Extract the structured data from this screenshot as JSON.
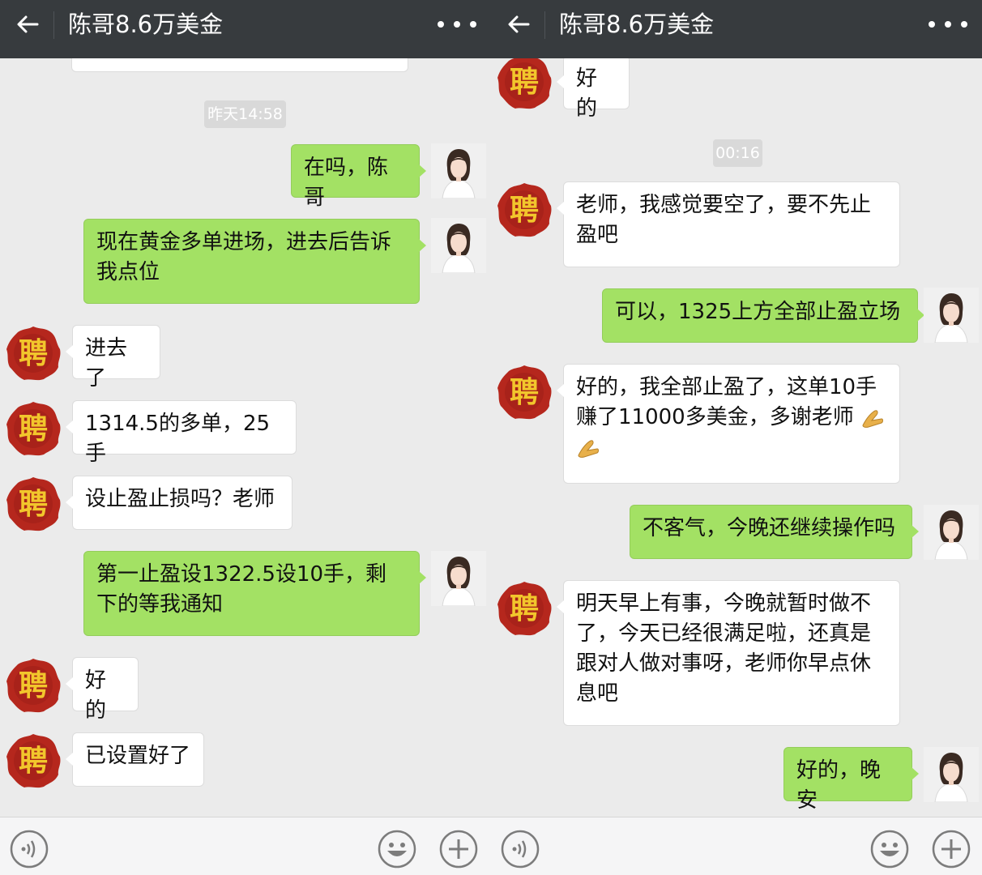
{
  "left": {
    "title": "陈哥8.6万美金",
    "timestamp": "昨天14:58",
    "messages": [
      {
        "side": "out",
        "text": "在吗，陈哥"
      },
      {
        "side": "out",
        "text": "现在黄金多单进场，进去后告诉我点位"
      },
      {
        "side": "in",
        "text": "进去了"
      },
      {
        "side": "in",
        "text": "1314.5的多单，25手"
      },
      {
        "side": "in",
        "text": "设止盈止损吗？老师"
      },
      {
        "side": "out",
        "text": "第一止盈设1322.5设10手，剩下的等我通知"
      },
      {
        "side": "in",
        "text": "好的"
      },
      {
        "side": "in",
        "text": "已设置好了"
      }
    ]
  },
  "right": {
    "title": "陈哥8.6万美金",
    "timestamp": "00:16",
    "messages": [
      {
        "side": "in",
        "text": "好的"
      },
      {
        "side": "in",
        "text": "老师，我感觉要空了，要不先止盈吧"
      },
      {
        "side": "out",
        "text": "可以，1325上方全部止盈立场"
      },
      {
        "side": "in",
        "text": "好的，我全部止盈了，这单10手赚了11000多美金，多谢老师"
      },
      {
        "side": "out",
        "text": "不客气，今晚还继续操作吗"
      },
      {
        "side": "in",
        "text": "明天早上有事，今晚就暂时做不了，今天已经很满足啦，还真是跟对人做对事呀，老师你早点休息吧"
      },
      {
        "side": "out",
        "text": "好的，晚安"
      }
    ]
  },
  "avatars": {
    "contact": "seal-avatar with character 聘",
    "seal_char": "聘",
    "self": "woman-photo-avatar"
  },
  "icons": {
    "back": "back-arrow-icon",
    "more": "more-dots-icon",
    "voice": "voice-icon",
    "emoji": "emoji-icon",
    "plus": "plus-icon",
    "emoji_in_message": "folded-hands-icon"
  },
  "colors": {
    "topbar": "#373b3e",
    "chat_bg": "#ebebeb",
    "bubble_out": "#a3e164",
    "bubble_in": "#ffffff",
    "seal_red": "#b5271d",
    "seal_gold": "#f2c62c"
  }
}
